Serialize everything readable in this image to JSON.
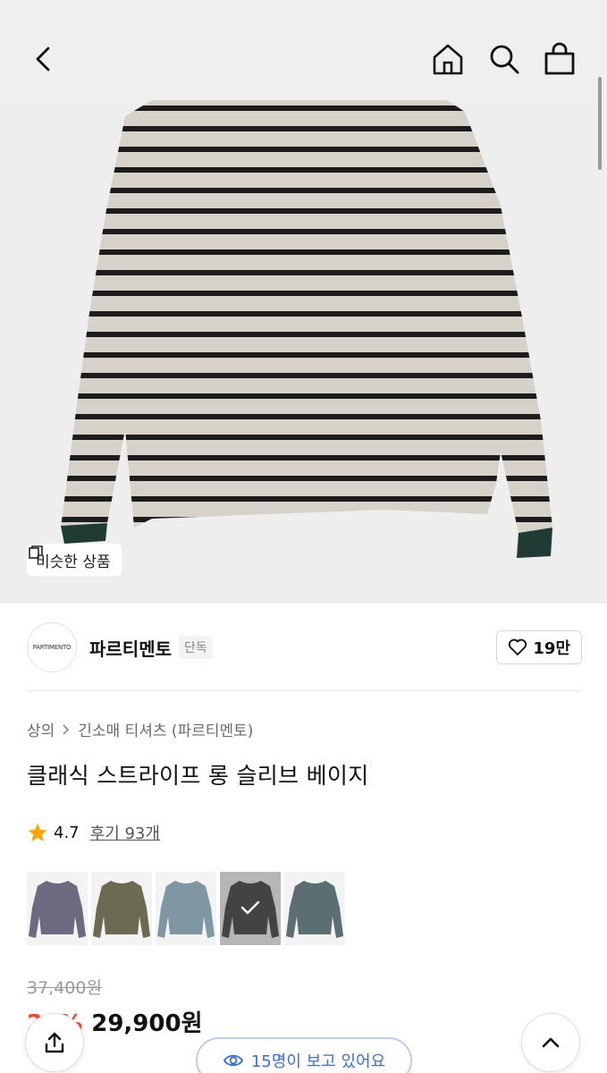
{
  "nav": {
    "back_icon": "chevron-left-icon",
    "home_icon": "home-icon",
    "search_icon": "search-icon",
    "cart_icon": "shopping-bag-icon"
  },
  "hero": {
    "similar_label": "비슷한 상품",
    "stripe_color": "#1c1c1c",
    "base_color": "#d6d1c9",
    "cuff_color": "#1f3b33"
  },
  "brand": {
    "logo_text": "PARTIMENTO",
    "name": "파르티멘토",
    "tag": "단독",
    "likes": "19만"
  },
  "breadcrumb": {
    "category": "상의",
    "subcategory": "긴소매 티셔츠 (파르티멘토)"
  },
  "product": {
    "title": "클래식 스트라이프 롱 슬리브 베이지",
    "rating": "4.7",
    "reviews_label": "후기 93개"
  },
  "swatches": [
    {
      "name": "purple-grey",
      "color": "#6b6a80",
      "selected": false
    },
    {
      "name": "olive",
      "color": "#6d6a52",
      "selected": false
    },
    {
      "name": "blue-grey",
      "color": "#7f97a2",
      "selected": false
    },
    {
      "name": "charcoal",
      "color": "#5a5a5a",
      "selected": true
    },
    {
      "name": "teal-grey",
      "color": "#5b6f72",
      "selected": false
    }
  ],
  "price": {
    "original": "37,400원",
    "discount": "20%",
    "final": "29,900원"
  },
  "viewing": {
    "text": "15명이 보고 있어요"
  },
  "colors": {
    "accent": "#3c6fd6",
    "sale": "#f0462b",
    "star": "#f6a800"
  }
}
